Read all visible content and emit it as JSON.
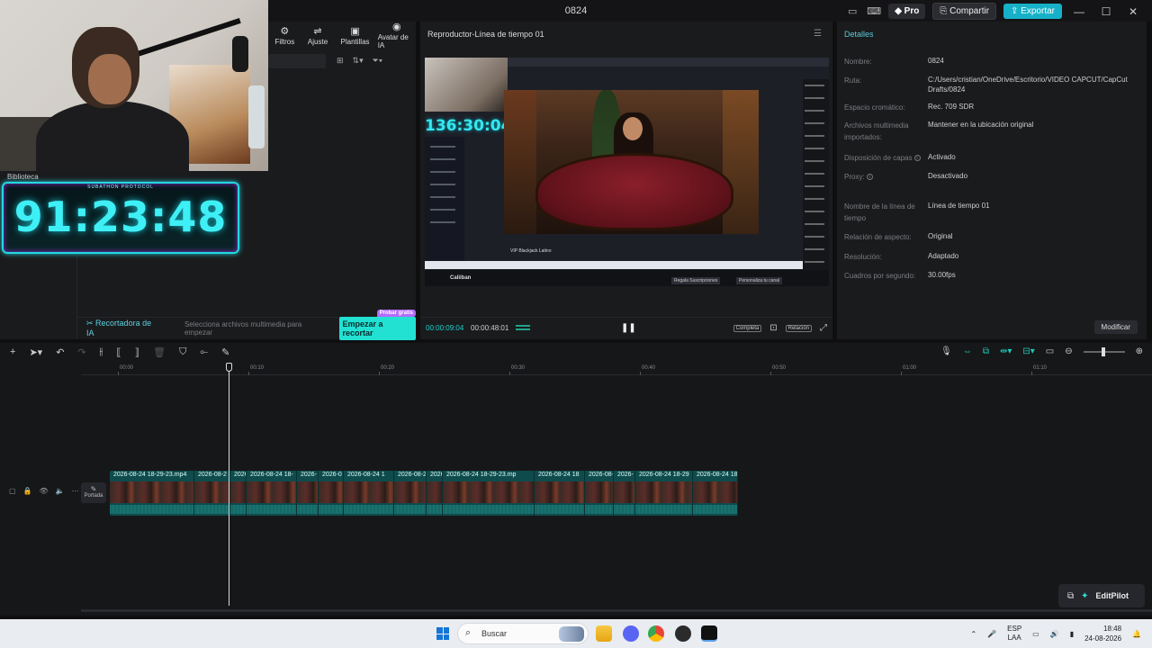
{
  "window": {
    "title": "0824",
    "pro_label": "Pro",
    "share_label": "Compartir",
    "export_label": "Exportar"
  },
  "overlay": {
    "timer_caption": "SUBATHON PROTOCOL",
    "timer_value": "91:23:48",
    "library_tab": "Biblioteca"
  },
  "media_toolbar": [
    {
      "icon": "filters-icon",
      "glyph": "⚙",
      "label": "Filtros"
    },
    {
      "icon": "adjust-icon",
      "glyph": "⇌",
      "label": "Ajuste"
    },
    {
      "icon": "templates-icon",
      "glyph": "▣",
      "label": "Plantillas"
    },
    {
      "icon": "ai-avatar-icon",
      "glyph": "◉",
      "label": "Avatar de IA"
    }
  ],
  "media_footer": {
    "ai_label": "Recortadora de IA",
    "hint": "Selecciona archivos multimedia para empezar",
    "cut_button": "Empezar a recortar",
    "trial_tag": "Probar gratis"
  },
  "player": {
    "title": "Reproductor-Línea de tiempo 01",
    "preview": {
      "stream_timer": "136:30:04",
      "caption": "VIP Blackjack Latino",
      "channel": "Caliiban",
      "sub_btn": "Regala Suscripciones",
      "custom_btn": "Personaliza tu canal"
    },
    "current_time": "00:00:09:04",
    "duration": "00:00:48:01",
    "full_label": "Completa",
    "ratio_label": "Relación"
  },
  "details": {
    "header": "Detalles",
    "rows": [
      {
        "key": "Nombre:",
        "value": "0824"
      },
      {
        "key": "Ruta:",
        "value": "C:/Users/cristian/OneDrive/Escritorio/VIDEO CAPCUT/CapCut Drafts/0824"
      },
      {
        "key": "Espacio cromático:",
        "value": "Rec. 709 SDR"
      },
      {
        "key": "Archivos multimedia importados:",
        "value": "Mantener en la ubicación original"
      },
      {
        "key": "Disposición de capas",
        "value": "Activado"
      },
      {
        "key": "Proxy:",
        "value": "Desactivado"
      },
      {
        "key": "Nombre de la línea de tiempo",
        "value": "Línea de tiempo 01"
      },
      {
        "key": "Relación de aspecto:",
        "value": "Original"
      },
      {
        "key": "Resolución:",
        "value": "Adaptado"
      },
      {
        "key": "Cuadros por segundo:",
        "value": "30.00fps"
      }
    ],
    "modify_button": "Modificar"
  },
  "timeline": {
    "ruler": [
      "00:00",
      "00:10",
      "00:20",
      "00:30",
      "00:40",
      "00:50",
      "01:00",
      "01:10"
    ],
    "cover_label": "Portada",
    "clips": [
      "2026-08-24 18-29-23.mp4",
      "2026-08-2",
      "2026",
      "2026-08-24 18-",
      "2026-",
      "2026-0",
      "2026-08-24 1",
      "2026-08-2",
      "2026",
      "2026-08-24 18-29-23.mp",
      "2026-08-24 18",
      "2026-08-",
      "2026-",
      "2026-08-24 18-29",
      "2026-08-24 18-29-2"
    ]
  },
  "editpilot": {
    "label": "EditPilot"
  },
  "taskbar": {
    "search_placeholder": "Buscar",
    "lang_top": "ESP",
    "lang_bottom": "LAA",
    "time": "18:48",
    "date": "24-08-2026"
  },
  "colors": {
    "accent": "#16b1c8",
    "timer_cyan": "#3ef0f6",
    "clip_bg": "#0f4b4c"
  }
}
